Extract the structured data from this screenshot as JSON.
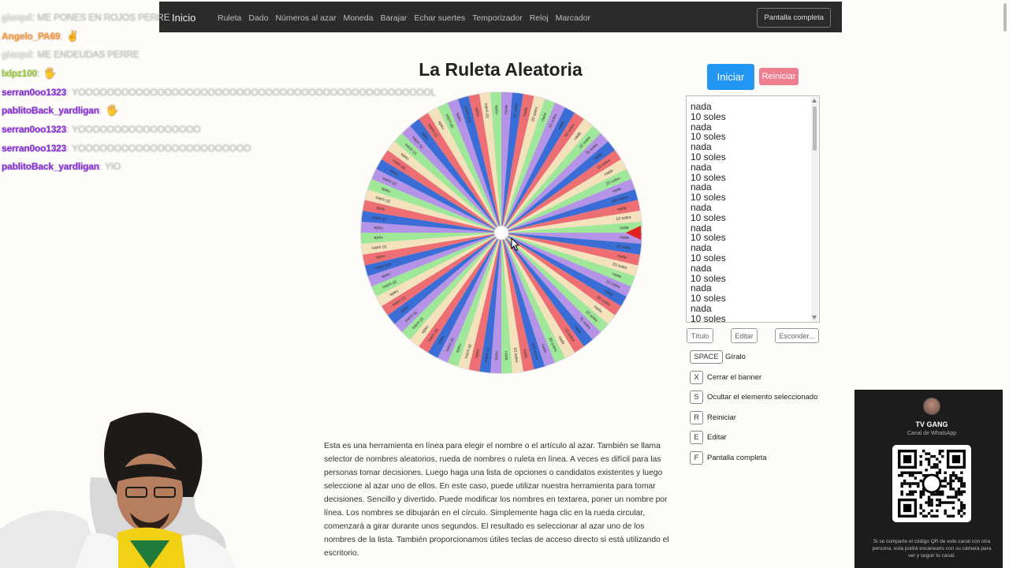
{
  "navbar": {
    "brand": "Inicio",
    "links": [
      "Ruleta",
      "Dado",
      "Números al azar",
      "Moneda",
      "Barajar",
      "Echar suertes",
      "Temporizador",
      "Reloj",
      "Marcador"
    ],
    "fullscreen_label": "Pantalla completa"
  },
  "chat": [
    {
      "user": "gianpd",
      "user_color": "#e7e7e7",
      "message": "ME PONES EN ROJOS PERRE",
      "emote": ""
    },
    {
      "user": "Angelo_PA69",
      "user_color": "#ff9b38",
      "message": "",
      "emote": "✌"
    },
    {
      "user": "gianpd",
      "user_color": "#e7e7e7",
      "message": "ME ENDEUDAS PERRE",
      "emote": ""
    },
    {
      "user": "lxlpz100",
      "user_color": "#9acd32",
      "message": "",
      "emote": "🖐"
    },
    {
      "user": "serran0oo1323",
      "user_color": "#8a2be2",
      "message": "YOOOOOOOOOOOOOOOOOOOOOOOOOOOOOOOOOOOOOOOOOOOOOOOOOL",
      "emote": ""
    },
    {
      "user": "pablitoBack_yardligan",
      "user_color": "#8a2be2",
      "message": "",
      "emote": "🖐"
    },
    {
      "user": "serran0oo1323",
      "user_color": "#8a2be2",
      "message": "YOOOOOOOOOOOOOOOOO",
      "emote": ""
    },
    {
      "user": "serran0oo1323",
      "user_color": "#8a2be2",
      "message": "YOOOOOOOOOOOOOOOOOOOOOOOO",
      "emote": ""
    },
    {
      "user": "pablitoBack_yardligan",
      "user_color": "#8a2be2",
      "message": "YIO",
      "emote": ""
    }
  ],
  "page": {
    "title": "La Ruleta Aleatoria",
    "start_label": "Iniciar",
    "reset_label": "Reiniciar",
    "title_btn": "Título",
    "edit_btn": "Editar",
    "hide_btn": "Esconder..."
  },
  "options": [
    "nada",
    "10 soles",
    "nada",
    "10 soles",
    "nada",
    "10 soles",
    "nada",
    "10 soles",
    "nada",
    "10 soles",
    "nada",
    "10 soles",
    "nada",
    "10 soles",
    "nada",
    "10 soles",
    "nada",
    "10 soles",
    "nada",
    "10 soles",
    "nada",
    "10 soles"
  ],
  "wheel": {
    "colors": [
      "#b594e8",
      "#3a6ed6",
      "#ee6f73",
      "#f4e2bc",
      "#9fe89a"
    ],
    "pointer_color": "#e52020",
    "segment_count": 80,
    "visible_labels": [
      "nada",
      "10 soles",
      "nada",
      "20 soles",
      "nada",
      "10 soles",
      "nada",
      "50 soles",
      "nada",
      "10 soles",
      "75 soles",
      "nada",
      "10 soles",
      "nada",
      "20 soles",
      "nada",
      "100 soles",
      "nada",
      "10 soles",
      "nada"
    ]
  },
  "shortcuts": [
    {
      "key": "SPACE",
      "label": "Gíralo"
    },
    {
      "key": "X",
      "label": "Cerrar el banner"
    },
    {
      "key": "S",
      "label": "Ocultar el elemento seleccionado"
    },
    {
      "key": "R",
      "label": "Reiniciar"
    },
    {
      "key": "E",
      "label": "Editar"
    },
    {
      "key": "F",
      "label": "Pantalla completa"
    }
  ],
  "description": "Esta es una herramienta en línea para elegir el nombre o el artículo al azar. También se llama selector de nombres aleatorios, rueda de nombres o ruleta en línea. A veces es difícil para las personas tomar decisiones. Luego haga una lista de opciones o candidatos existentes y luego seleccione al azar uno de ellos. En este caso, puede utilizar nuestra herramienta para tomar decisiones. Sencillo y divertido. Puede modificar los nombres en textarea, poner un nombre por línea. Los nombres se dibujarán en el círculo. Simplemente haga clic en la rueda circular, comenzará a girar durante unos segundos. El resultado es seleccionar al azar uno de los nombres de la lista. También proporcionamos útiles teclas de acceso directo si está utilizando el escritorio.",
  "promo": {
    "name": "TV GANG",
    "subtitle": "Canal de WhatsApp",
    "note": "Si se comparte el código QR de este canal con otra persona, esta podrá escanearlo con su cámara para ver y seguir tu canal."
  }
}
